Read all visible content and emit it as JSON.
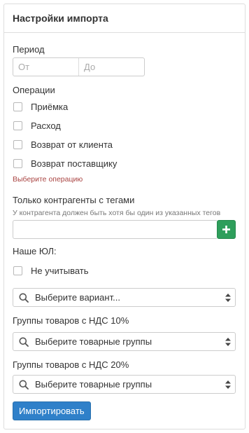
{
  "panel": {
    "title": "Настройки импорта"
  },
  "period": {
    "label": "Период",
    "from_placeholder": "От",
    "to_placeholder": "До"
  },
  "operations": {
    "label": "Операции",
    "items": [
      {
        "label": "Приёмка",
        "checked": false
      },
      {
        "label": "Расход",
        "checked": false
      },
      {
        "label": "Возврат от клиента",
        "checked": false
      },
      {
        "label": "Возврат поставщику",
        "checked": false
      }
    ],
    "error": "Выберите операцию"
  },
  "tags": {
    "label": "Только контрагенты с тегами",
    "hint": "У контрагента должен быть хотя бы один из указанных тегов",
    "add_icon": "plus-icon"
  },
  "legal_entity": {
    "label": "Наше ЮЛ:",
    "ignore_label": "Не учитывать",
    "select_placeholder": "Выберите вариант..."
  },
  "vat10": {
    "label": "Группы товаров с НДС 10%",
    "select_placeholder": "Выберите товарные группы"
  },
  "vat20": {
    "label": "Группы товаров с НДС 20%",
    "select_placeholder": "Выберите товарные группы"
  },
  "actions": {
    "import_label": "Импортировать"
  },
  "colors": {
    "primary": "#2f80c9",
    "success": "#2e9e5b",
    "error": "#a94442",
    "border": "#dddddd"
  }
}
